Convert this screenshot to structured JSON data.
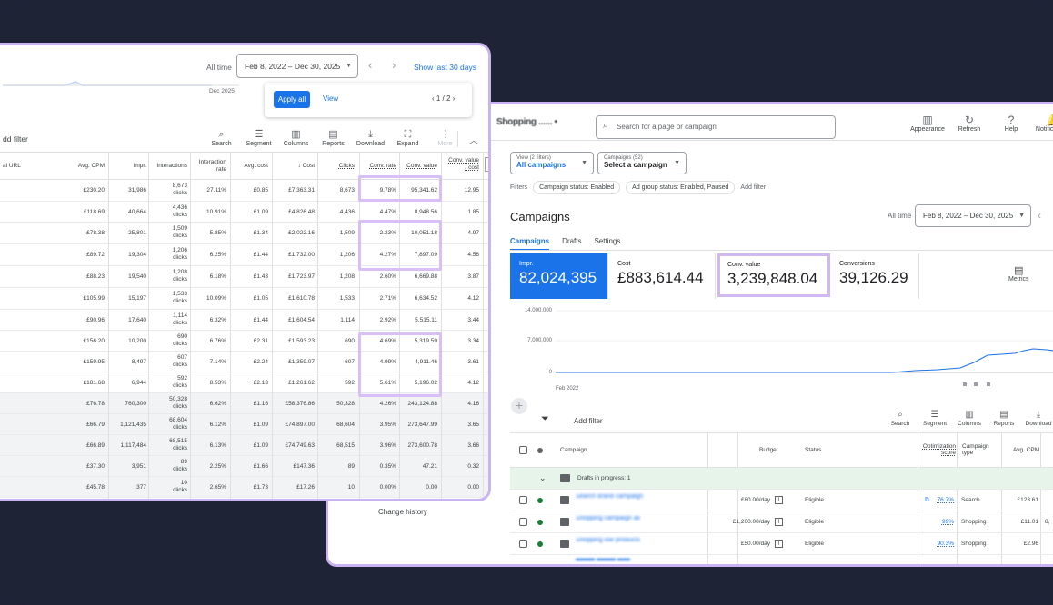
{
  "back_window": {
    "brand": "Shopping ...... •",
    "search_placeholder": "Search for a page or campaign",
    "tools": [
      {
        "icon": "appearance-icon",
        "glyph": "▥",
        "label": "Appearance"
      },
      {
        "icon": "refresh-icon",
        "glyph": "↻",
        "label": "Refresh"
      },
      {
        "icon": "help-icon",
        "glyph": "?",
        "label": "Help"
      },
      {
        "icon": "notifications-icon",
        "glyph": "🔔",
        "label": "Notifications"
      }
    ],
    "notif_count": "1",
    "view_sub": "View (2 filters)",
    "view_main": "All campaigns",
    "campaigns_sub": "Campaigns (52)",
    "campaigns_main": "Select a campaign",
    "filters_label": "Filters",
    "filter_chips": [
      "Campaign status: Enabled",
      "Ad group status: Enabled, Paused"
    ],
    "add_filter": "Add filter",
    "title": "Campaigns",
    "all_time": "All time",
    "date_range": "Feb 8, 2022 – Dec 30, 2025",
    "tabs": [
      "Campaigns",
      "Drafts",
      "Settings"
    ],
    "metrics": [
      {
        "label": "Impr.",
        "value": "82,024,395"
      },
      {
        "label": "Cost",
        "value": "£883,614.44"
      },
      {
        "label": "Conv. value",
        "value": "3,239,848.04"
      },
      {
        "label": "Conversions",
        "value": "39,126.29"
      }
    ],
    "metrics_btn": "Metrics",
    "chart": {
      "y_ticks": [
        "14,000,000",
        "7,000,000",
        "0"
      ],
      "x_label": "Feb 2022"
    },
    "table_add_filter": "Add filter",
    "table_tools": [
      {
        "icon": "search-icon",
        "glyph": "⌕",
        "label": "Search"
      },
      {
        "icon": "segment-icon",
        "glyph": "☰",
        "label": "Segment"
      },
      {
        "icon": "columns-icon",
        "glyph": "▥",
        "label": "Columns"
      },
      {
        "icon": "reports-icon",
        "glyph": "▤",
        "label": "Reports"
      },
      {
        "icon": "download-icon",
        "glyph": "⤓",
        "label": "Download"
      }
    ],
    "headers": {
      "campaign": "Campaign",
      "budget": "Budget",
      "status": "Status",
      "opt_score": "Optimization score",
      "campaign_type": "Campaign type",
      "avg_cpm": "Avg. CPM"
    },
    "draft_row": "Drafts in progress: 1",
    "rows": [
      {
        "name": "Search brand campaign",
        "budget": "£80.00/day",
        "status": "Eligible",
        "score": "76.7%",
        "type": "Search",
        "cpm": "£123.61"
      },
      {
        "name": "Shopping campaign all",
        "budget": "£1,200.00/day",
        "status": "Eligible",
        "score": "99%",
        "type": "Shopping",
        "cpm": "£11.01"
      },
      {
        "name": "Shopping low products",
        "budget": "£50.00/day",
        "status": "Eligible",
        "score": "90.3%",
        "type": "Shopping",
        "cpm": "£2.96"
      }
    ],
    "row_extra": "8,",
    "change_history": "Change history"
  },
  "front_window": {
    "all_time": "All time",
    "date_range": "Feb 8, 2022 – Dec 30, 2025",
    "show_last": "Show last 30 days",
    "chart_end_label": "Dec 2025",
    "apply_all": "Apply all",
    "view": "View",
    "pager": "‹  1 / 2  ›",
    "add_filter": "dd filter",
    "tools": [
      {
        "icon": "search-icon",
        "glyph": "⌕",
        "label": "Search"
      },
      {
        "icon": "segment-icon",
        "glyph": "☰",
        "label": "Segment"
      },
      {
        "icon": "columns-icon",
        "glyph": "▥",
        "label": "Columns"
      },
      {
        "icon": "reports-icon",
        "glyph": "▤",
        "label": "Reports"
      },
      {
        "icon": "download-icon",
        "glyph": "⤓",
        "label": "Download"
      },
      {
        "icon": "expand-icon",
        "glyph": "⛶",
        "label": "Expand"
      },
      {
        "icon": "more-icon",
        "glyph": "⋮",
        "label": "More"
      }
    ],
    "headers": {
      "url": "al URL",
      "cpm": "Avg. CPM",
      "impr": "Impr.",
      "interactions": "Interactions",
      "int_rate_1": "Interaction",
      "int_rate_2": "rate",
      "avg_cost": "Avg. cost",
      "cost": "↓ Cost",
      "clicks": "Clicks",
      "conv_rate": "Conv. rate",
      "conv_value": "Conv. value",
      "cvc_1": "Conv. value",
      "cvc_2": "/ cost"
    },
    "rows": [
      {
        "cpm": "£230.20",
        "impr": "31,986",
        "inter": "8,673",
        "rate": "27.11%",
        "avg": "£0.85",
        "cost": "£7,363.31",
        "clicks": "8,673",
        "cr": "9.78%",
        "cv": "95,341.62",
        "cvc": "12.95"
      },
      {
        "cpm": "£118.69",
        "impr": "40,664",
        "inter": "4,436",
        "rate": "10.91%",
        "avg": "£1.09",
        "cost": "£4,826.48",
        "clicks": "4,436",
        "cr": "4.47%",
        "cv": "8,948.56",
        "cvc": "1.85"
      },
      {
        "cpm": "£78.38",
        "impr": "25,801",
        "inter": "1,509",
        "rate": "5.85%",
        "avg": "£1.34",
        "cost": "£2,022.16",
        "clicks": "1,509",
        "cr": "2.23%",
        "cv": "10,051.18",
        "cvc": "4.97"
      },
      {
        "cpm": "£89.72",
        "impr": "19,304",
        "inter": "1,206",
        "rate": "6.25%",
        "avg": "£1.44",
        "cost": "£1,732.00",
        "clicks": "1,206",
        "cr": "4.27%",
        "cv": "7,897.09",
        "cvc": "4.56"
      },
      {
        "cpm": "£88.23",
        "impr": "19,540",
        "inter": "1,208",
        "rate": "6.18%",
        "avg": "£1.43",
        "cost": "£1,723.97",
        "clicks": "1,208",
        "cr": "2.60%",
        "cv": "6,669.88",
        "cvc": "3.87"
      },
      {
        "cpm": "£105.99",
        "impr": "15,197",
        "inter": "1,533",
        "rate": "10.09%",
        "avg": "£1.05",
        "cost": "£1,610.78",
        "clicks": "1,533",
        "cr": "2.71%",
        "cv": "6,634.52",
        "cvc": "4.12"
      },
      {
        "cpm": "£90.96",
        "impr": "17,640",
        "inter": "1,114",
        "rate": "6.32%",
        "avg": "£1.44",
        "cost": "£1,604.54",
        "clicks": "1,114",
        "cr": "2.92%",
        "cv": "5,515.11",
        "cvc": "3.44"
      },
      {
        "cpm": "£156.20",
        "impr": "10,200",
        "inter": "690",
        "rate": "6.76%",
        "avg": "£2.31",
        "cost": "£1,593.23",
        "clicks": "690",
        "cr": "4.69%",
        "cv": "5,319.59",
        "cvc": "3.34"
      },
      {
        "cpm": "£159.95",
        "impr": "8,497",
        "inter": "607",
        "rate": "7.14%",
        "avg": "£2.24",
        "cost": "£1,359.07",
        "clicks": "607",
        "cr": "4.99%",
        "cv": "4,911.46",
        "cvc": "3.61"
      },
      {
        "cpm": "£181.68",
        "impr": "6,944",
        "inter": "592",
        "rate": "8.53%",
        "avg": "£2.13",
        "cost": "£1,261.62",
        "clicks": "592",
        "cr": "5.61%",
        "cv": "5,196.02",
        "cvc": "4.12"
      },
      {
        "cpm": "£76.78",
        "impr": "760,300",
        "inter": "50,328",
        "rate": "6.62%",
        "avg": "£1.16",
        "cost": "£58,376.86",
        "clicks": "50,328",
        "cr": "4.26%",
        "cv": "243,124.88",
        "cvc": "4.16"
      },
      {
        "cpm": "£66.79",
        "impr": "1,121,435",
        "inter": "68,604",
        "rate": "6.12%",
        "avg": "£1.09",
        "cost": "£74,897.00",
        "clicks": "68,604",
        "cr": "3.95%",
        "cv": "273,647.99",
        "cvc": "3.65"
      },
      {
        "cpm": "£66.89",
        "impr": "1,117,484",
        "inter": "68,515",
        "rate": "6.13%",
        "avg": "£1.09",
        "cost": "£74,749.63",
        "clicks": "68,515",
        "cr": "3.96%",
        "cv": "273,600.78",
        "cvc": "3.66"
      },
      {
        "cpm": "£37.30",
        "impr": "3,951",
        "inter": "89",
        "rate": "2.25%",
        "avg": "£1.66",
        "cost": "£147.36",
        "clicks": "89",
        "cr": "0.35%",
        "cv": "47.21",
        "cvc": "0.32"
      },
      {
        "cpm": "£45.78",
        "impr": "377",
        "inter": "10",
        "rate": "2.65%",
        "avg": "£1.73",
        "cost": "£17.26",
        "clicks": "10",
        "cr": "0.00%",
        "cv": "0.00",
        "cvc": "0.00"
      }
    ],
    "clicks_word": "clicks"
  }
}
